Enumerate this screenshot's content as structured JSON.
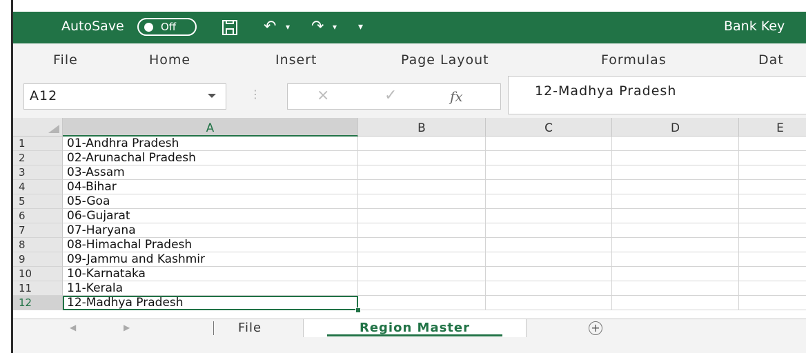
{
  "title_bar": {
    "autosave_label": "AutoSave",
    "autosave_state": "Off",
    "document_title": "Bank Key"
  },
  "menu": {
    "tabs": [
      "File",
      "Home",
      "Insert",
      "Page Layout",
      "Formulas",
      "Dat"
    ]
  },
  "formula_bar": {
    "name_box": "A12",
    "cancel_icon": "×",
    "enter_icon": "✓",
    "fx_label": "fx",
    "value": "12-Madhya Pradesh"
  },
  "grid": {
    "columns": [
      "A",
      "B",
      "C",
      "D",
      "E"
    ],
    "selected_column": "A",
    "rows": [
      {
        "num": "1",
        "a": "01-Andhra Pradesh"
      },
      {
        "num": "2",
        "a": "02-Arunachal Pradesh"
      },
      {
        "num": "3",
        "a": "03-Assam"
      },
      {
        "num": "4",
        "a": "04-Bihar"
      },
      {
        "num": "5",
        "a": "05-Goa"
      },
      {
        "num": "6",
        "a": "06-Gujarat"
      },
      {
        "num": "7",
        "a": "07-Haryana"
      },
      {
        "num": "8",
        "a": "08-Himachal Pradesh"
      },
      {
        "num": "9",
        "a": "09-Jammu and Kashmir"
      },
      {
        "num": "10",
        "a": "10-Karnataka"
      },
      {
        "num": "11",
        "a": "11-Kerala"
      },
      {
        "num": "12",
        "a": "12-Madhya Pradesh"
      }
    ],
    "active_row": "12"
  },
  "sheets": {
    "tabs": [
      "File",
      "Region Master"
    ],
    "active": "Region Master",
    "add_icon": "plus-circle-icon"
  },
  "colors": {
    "accent": "#217346"
  }
}
